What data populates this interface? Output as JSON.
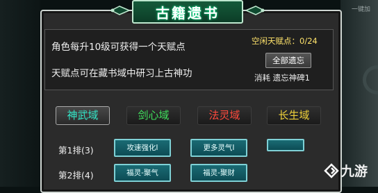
{
  "window": {
    "top_hint": "一键加"
  },
  "panel": {
    "title": "古籍遗书",
    "info": {
      "line1": "角色每升10级可获得一个天赋点",
      "line2": "天赋点可在藏书域中研习上古神功",
      "free_points": "空闲天赋点：0/24",
      "reset_button": "全部遗忘",
      "cost": "消耗  遗忘神碑1"
    },
    "domains": [
      {
        "label": "神武域",
        "color": "#33e6c8"
      },
      {
        "label": "剑心域",
        "color": "#3fe05c"
      },
      {
        "label": "法灵域",
        "color": "#ff4a3d"
      },
      {
        "label": "长生域",
        "color": "#f0d23a"
      }
    ],
    "rows": [
      {
        "label": "第1排(3)",
        "skills": [
          "攻速强化I",
          "更多灵气I",
          ""
        ]
      },
      {
        "label": "第2排(4)",
        "skills": [
          "福灵-聚气",
          "福灵-聚财"
        ]
      }
    ]
  },
  "watermark": {
    "text": "九游"
  },
  "colors": {
    "skill_bg": "#0d4c55",
    "skill_border": "#7fd1d6",
    "title_green": "#0c3d27"
  }
}
